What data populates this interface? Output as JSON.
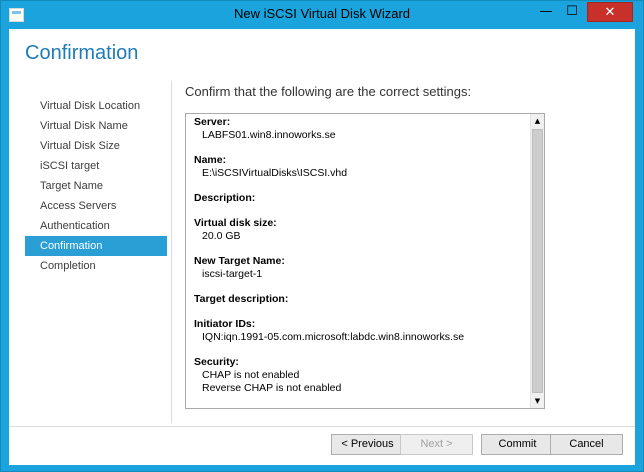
{
  "window": {
    "title": "New iSCSI Virtual Disk Wizard",
    "minimize_glyph": "—",
    "maximize_glyph": "☐",
    "close_glyph": "✕",
    "accent_color": "#1aa3dc",
    "close_color": "#c7312a"
  },
  "page": {
    "title": "Confirmation",
    "heading": "Confirm that the following are the correct settings:"
  },
  "nav": {
    "items": [
      {
        "label": "Virtual Disk Location"
      },
      {
        "label": "Virtual Disk Name"
      },
      {
        "label": "Virtual Disk Size"
      },
      {
        "label": "iSCSI target"
      },
      {
        "label": "Target Name"
      },
      {
        "label": "Access Servers"
      },
      {
        "label": "Authentication"
      },
      {
        "label": "Confirmation"
      },
      {
        "label": "Completion"
      }
    ],
    "active": "Confirmation",
    "active_color": "#2a9fd6"
  },
  "summary": {
    "entries": [
      {
        "label": "Server:",
        "values": [
          "LABFS01.win8.innoworks.se"
        ]
      },
      {
        "label": "Name:",
        "values": [
          "E:\\iSCSIVirtualDisks\\ISCSI.vhd"
        ]
      },
      {
        "label": "Description:",
        "values": []
      },
      {
        "label": "Virtual disk size:",
        "values": [
          "20.0 GB"
        ]
      },
      {
        "label": "New Target Name:",
        "values": [
          "iscsi-target-1"
        ]
      },
      {
        "label": "Target description:",
        "values": []
      },
      {
        "label": "Initiator IDs:",
        "values": [
          "IQN:iqn.1991-05.com.microsoft:labdc.win8.innoworks.se"
        ]
      },
      {
        "label": "Security:",
        "values": [
          "CHAP is not enabled",
          "Reverse CHAP is not enabled"
        ]
      }
    ]
  },
  "scrollbar": {
    "up_glyph": "▲",
    "down_glyph": "▼"
  },
  "buttons": {
    "previous": "< Previous",
    "next": "Next >",
    "commit": "Commit",
    "cancel": "Cancel"
  }
}
